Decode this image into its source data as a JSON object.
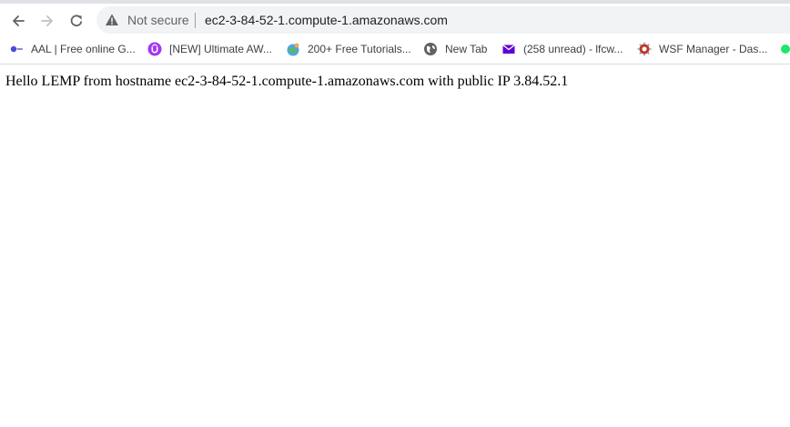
{
  "toolbar": {
    "back_icon": "arrow-left-icon",
    "forward_icon": "arrow-right-icon",
    "reload_icon": "reload-icon",
    "security_icon": "warning-triangle-icon",
    "security_label": "Not secure",
    "url": "ec2-3-84-52-1.compute-1.amazonaws.com"
  },
  "bookmarks": [
    {
      "label": "AAL | Free online G...",
      "icon": "aal-icon"
    },
    {
      "label": "[NEW] Ultimate AW...",
      "icon": "udemy-icon"
    },
    {
      "label": "200+ Free Tutorials...",
      "icon": "globe-colorful-icon"
    },
    {
      "label": "New Tab",
      "icon": "globe-icon"
    },
    {
      "label": "(258 unread) - lfcw...",
      "icon": "mail-icon"
    },
    {
      "label": "WSF Manager - Das...",
      "icon": "wsf-icon"
    }
  ],
  "page": {
    "text": "Hello LEMP from hostname ec2-3-84-52-1.compute-1.amazonaws.com with public IP 3.84.52.1"
  },
  "colors": {
    "accent_purple": "#6001d2",
    "udemy_purple": "#a435f0",
    "status_green": "#1ee86a"
  }
}
